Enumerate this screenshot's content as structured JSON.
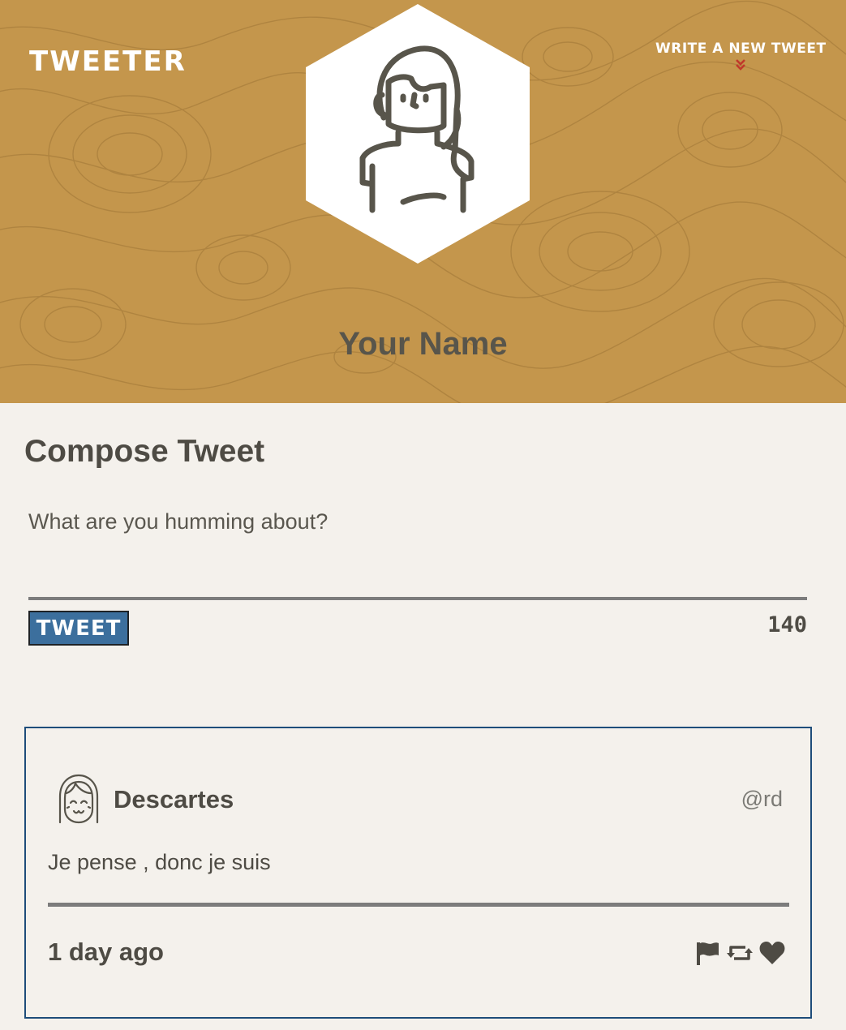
{
  "header": {
    "brand": "TWEETER",
    "compose_link": "WRITE A NEW TWEET",
    "user_name": "Your Name"
  },
  "compose": {
    "title": "Compose Tweet",
    "placeholder": "What are you humming about?",
    "button_label": "TWEET",
    "char_count": "140"
  },
  "tweets": [
    {
      "author": "Descartes",
      "handle": "@rd",
      "content": "Je pense , donc je suis",
      "time": "1 day ago",
      "actions": [
        "flag-icon",
        "retweet-icon",
        "heart-icon"
      ]
    }
  ],
  "colors": {
    "header_bg": "#c4964c",
    "page_bg": "#f4f1ec",
    "button_bg": "#3c6f9d",
    "card_border": "#1e4d7a",
    "chevron": "#c0392b",
    "text": "#4e4b44"
  }
}
